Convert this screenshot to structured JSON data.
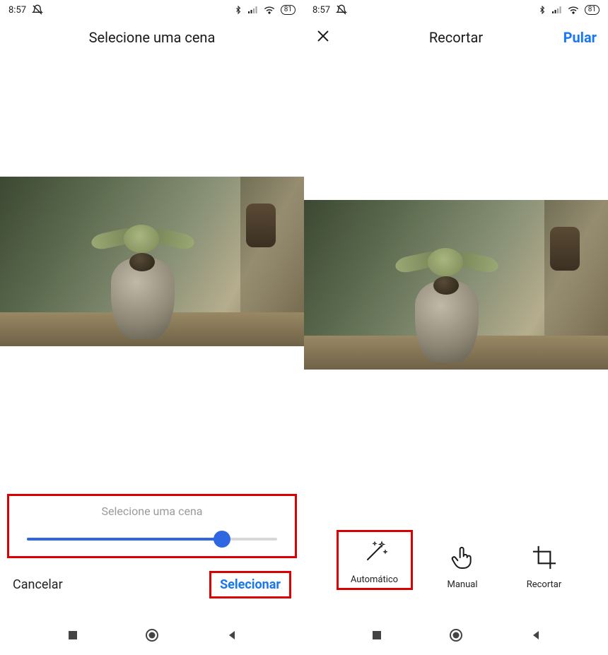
{
  "status": {
    "time": "8:57",
    "battery": "81"
  },
  "left": {
    "title": "Selecione uma cena",
    "slider": {
      "label": "Selecione uma cena",
      "percent": 78
    },
    "cancel": "Cancelar",
    "select": "Selecionar"
  },
  "right": {
    "title": "Recortar",
    "skip": "Pular",
    "tools": {
      "auto": "Automático",
      "manual": "Manual",
      "crop": "Recortar"
    }
  },
  "icons": {
    "close": "close-icon",
    "dnd": "do-not-disturb-icon",
    "bluetooth": "bluetooth-icon",
    "signal": "signal-icon",
    "wifi": "wifi-icon",
    "nav_square": "recents-icon",
    "nav_circle": "home-icon",
    "nav_back": "back-icon",
    "wand": "magic-wand-icon",
    "hand": "pointer-hand-icon",
    "crop": "crop-icon"
  }
}
